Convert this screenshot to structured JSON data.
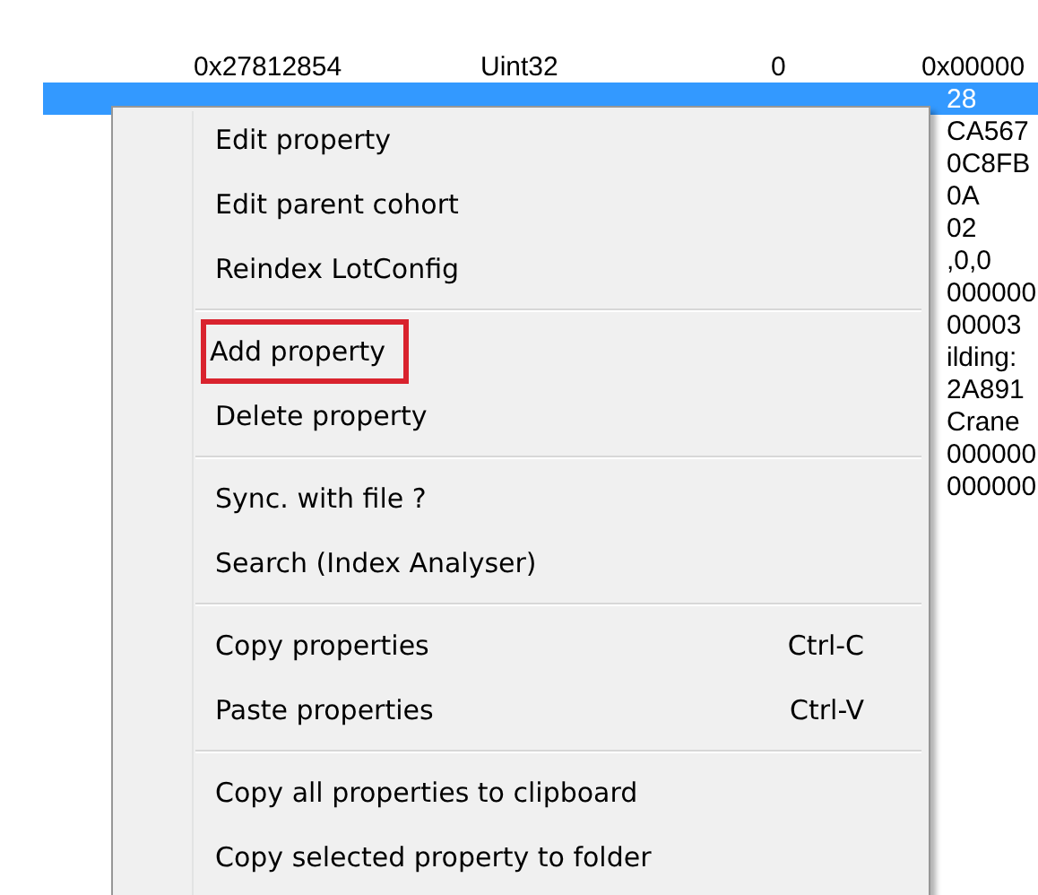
{
  "table": {
    "rows": [
      {
        "cells": [
          "0x27812854",
          "Uint32",
          "0",
          "0x00000"
        ],
        "selected": false
      },
      {
        "cells": [
          "",
          "",
          "",
          "28"
        ],
        "selected": true
      },
      {
        "cells": [
          "",
          "",
          "",
          "CA567"
        ],
        "selected": false
      },
      {
        "cells": [
          "",
          "",
          "",
          "0C8FB"
        ],
        "selected": false
      },
      {
        "cells": [
          "",
          "",
          "",
          "0A"
        ],
        "selected": false
      },
      {
        "cells": [
          "",
          "",
          "",
          "02"
        ],
        "selected": false
      },
      {
        "cells": [
          "",
          "",
          "",
          ",0,0"
        ],
        "selected": false
      },
      {
        "cells": [
          "",
          "",
          "",
          "000000"
        ],
        "selected": false
      },
      {
        "cells": [
          "",
          "",
          "",
          "00003"
        ],
        "selected": false
      },
      {
        "cells": [
          "",
          "",
          "",
          "ilding:"
        ],
        "selected": false
      },
      {
        "cells": [
          "",
          "",
          "",
          "2A891"
        ],
        "selected": false
      },
      {
        "cells": [
          "",
          "",
          "",
          "Crane"
        ],
        "selected": false
      },
      {
        "cells": [
          "",
          "",
          "",
          "000000"
        ],
        "selected": false
      },
      {
        "cells": [
          "",
          "",
          "",
          "000000"
        ],
        "selected": false
      }
    ]
  },
  "context_menu": {
    "groups": [
      [
        {
          "label": "Edit property",
          "highlighted": false
        },
        {
          "label": "Edit parent cohort",
          "highlighted": false
        },
        {
          "label": "Reindex LotConfig",
          "highlighted": false
        }
      ],
      [
        {
          "label": "Add property",
          "highlighted": true
        },
        {
          "label": "Delete property",
          "highlighted": false
        }
      ],
      [
        {
          "label": "Sync. with file ?",
          "highlighted": false
        },
        {
          "label": "Search (Index Analyser)",
          "highlighted": false
        }
      ],
      [
        {
          "label": "Copy properties",
          "shortcut": "Ctrl-C",
          "highlighted": false
        },
        {
          "label": "Paste properties",
          "shortcut": "Ctrl-V",
          "highlighted": false
        }
      ],
      [
        {
          "label": "Copy all properties to clipboard",
          "highlighted": false
        },
        {
          "label": "Copy selected property to folder",
          "highlighted": false
        }
      ]
    ]
  }
}
